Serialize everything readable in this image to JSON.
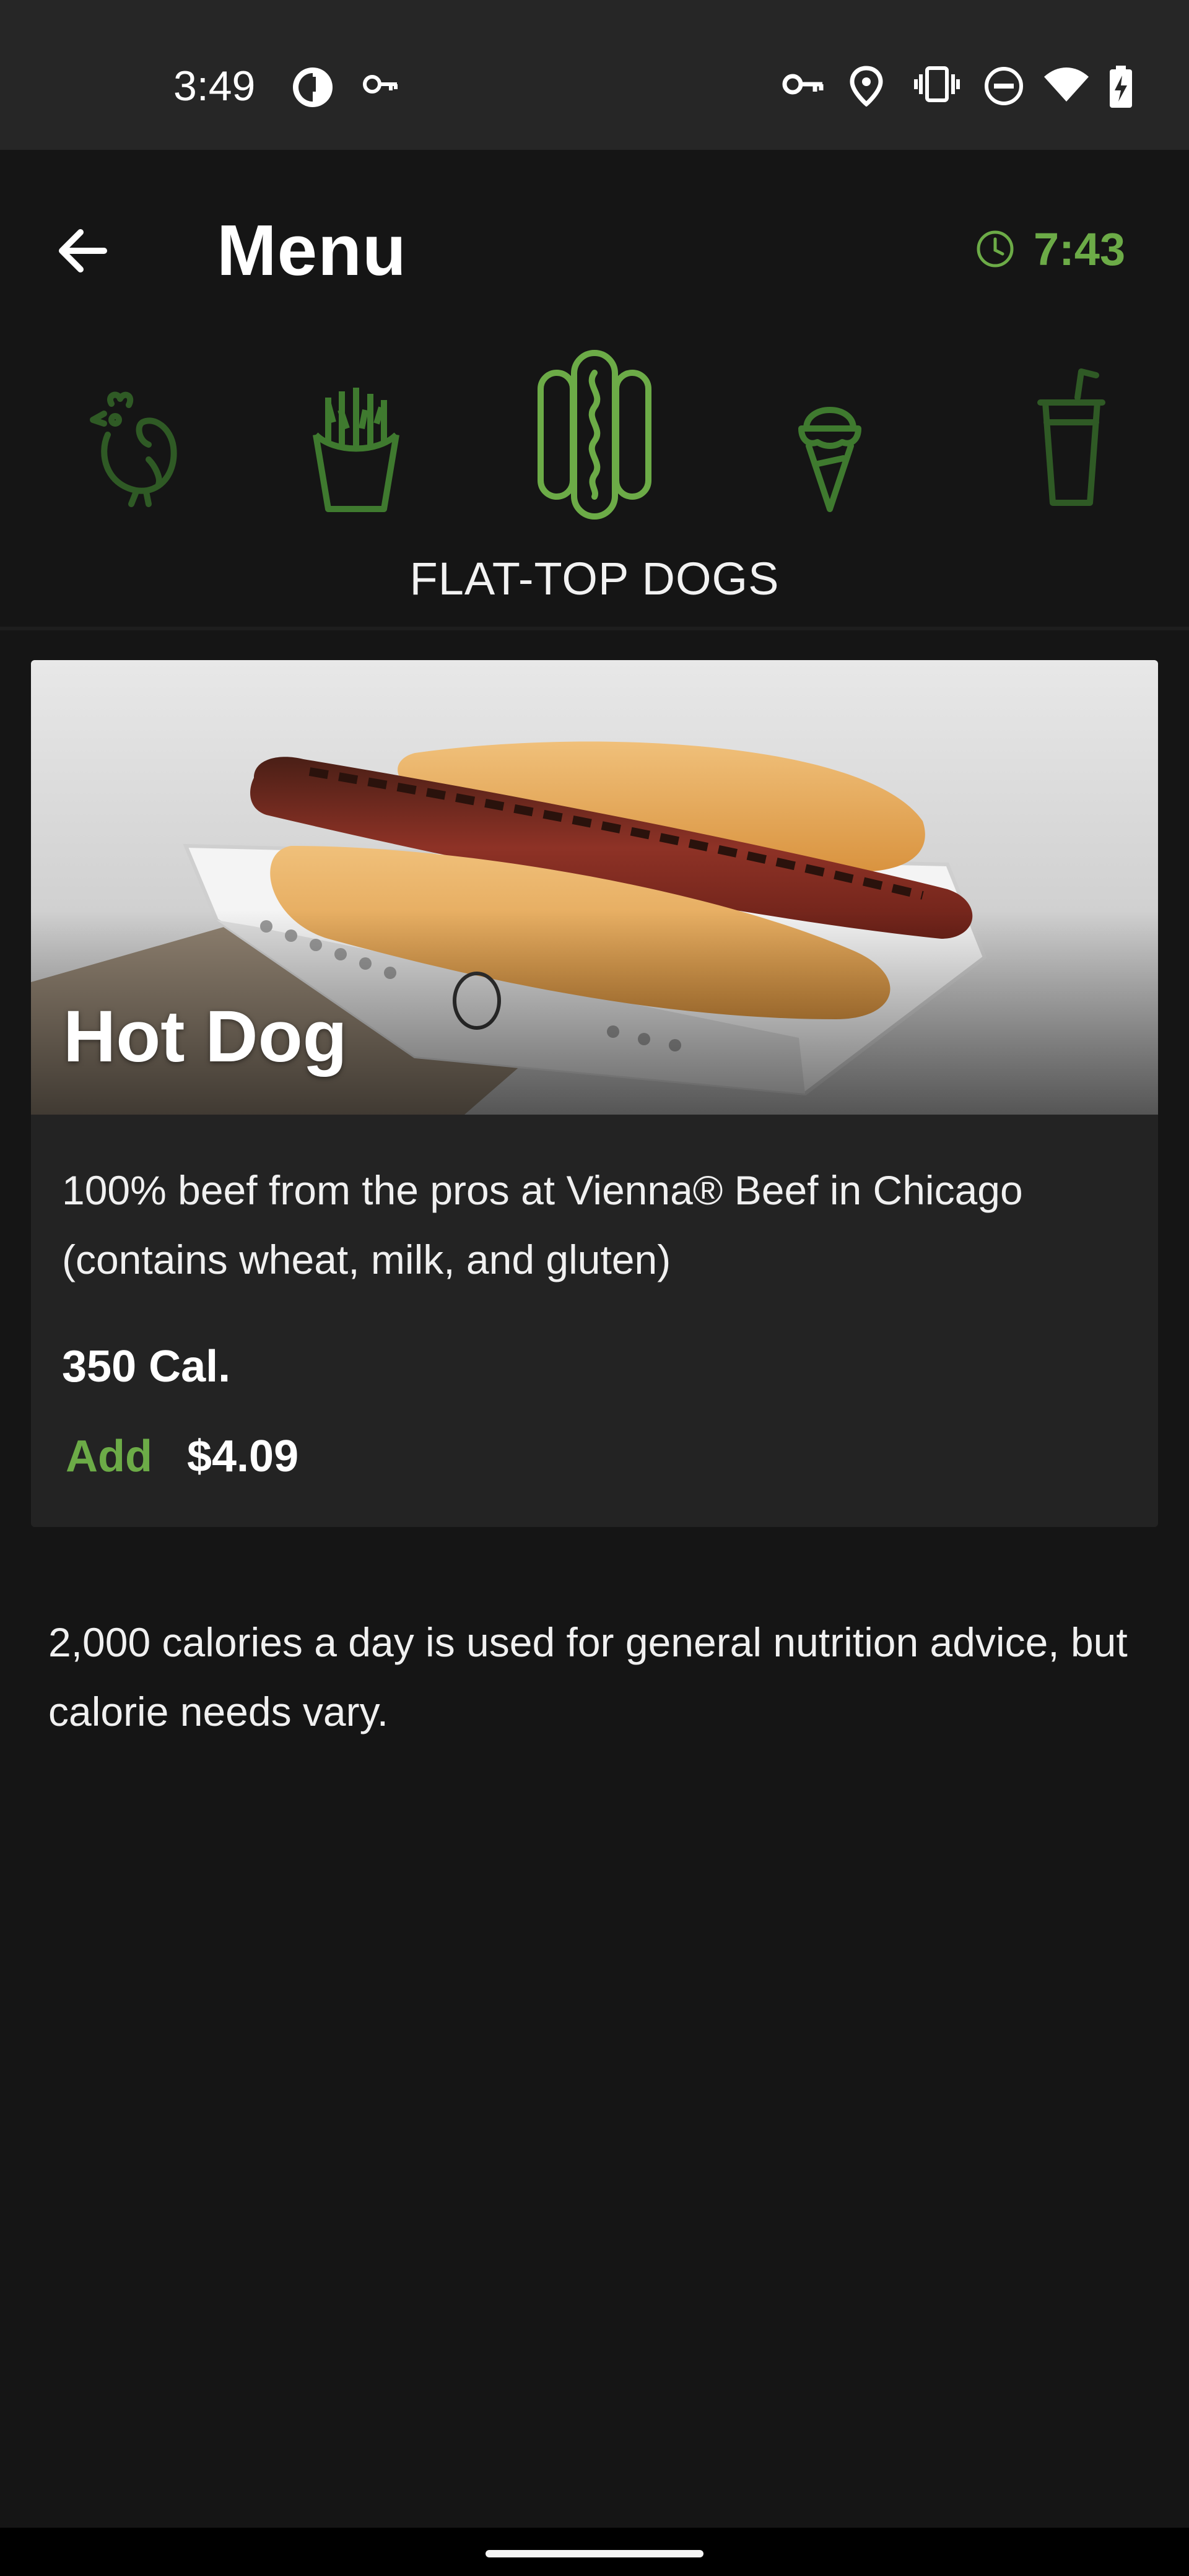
{
  "status_bar": {
    "time": "3:49",
    "left_icons": [
      "app-notification-icon",
      "key-icon"
    ],
    "right_icons": [
      "vpn-key-icon",
      "location-icon",
      "vibrate-icon",
      "do-not-disturb-icon",
      "wifi-icon",
      "battery-charging-icon"
    ]
  },
  "header": {
    "title": "Menu",
    "back_icon": "arrow-left-icon",
    "timer_icon": "clock-icon",
    "timer_value": "7:43"
  },
  "categories": {
    "items": [
      {
        "icon": "chicken-icon",
        "selected": false
      },
      {
        "icon": "fries-icon",
        "selected": false
      },
      {
        "icon": "hot-dog-icon",
        "selected": true
      },
      {
        "icon": "ice-cream-icon",
        "selected": false
      },
      {
        "icon": "drink-cup-icon",
        "selected": false
      }
    ],
    "selected_label": "FLAT-TOP DOGS"
  },
  "menu_item": {
    "name": "Hot Dog",
    "description": "100% beef from the pros at Vienna® Beef in Chicago (contains wheat, milk, and gluten)",
    "calories": "350 Cal.",
    "add_label": "Add",
    "price": "$4.09"
  },
  "disclaimer": "2,000 calories a day is used for general nutrition advice, but calorie needs vary.",
  "colors": {
    "accent_green": "#6cab47",
    "dim_green": "#2f5a25",
    "background": "#151515",
    "card": "#232323",
    "status_bar": "#262626"
  }
}
